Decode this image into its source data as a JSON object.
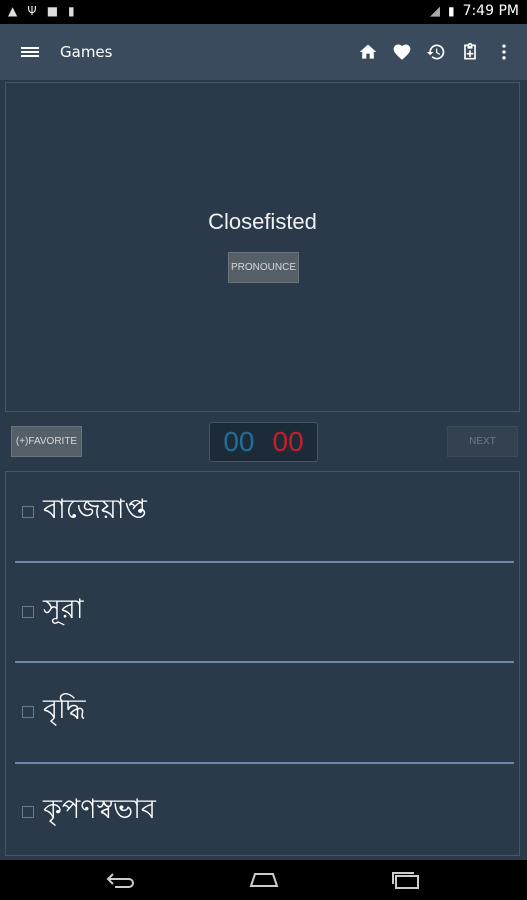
{
  "status_bar": {
    "time": "7:49",
    "time_suffix": "PM"
  },
  "app_bar": {
    "title": "Games",
    "actions": [
      "home-icon",
      "heart-icon",
      "history-icon",
      "clipboard-icon",
      "overflow-icon"
    ]
  },
  "quiz": {
    "word": "Closefisted",
    "pronounce_label": "PRONOUNCE",
    "favorite_label": "(+)FAVORITE",
    "next_label": "NEXT",
    "score_correct": "00",
    "score_wrong": "00",
    "options": [
      {
        "label": "বাজেয়াপ্ত",
        "checked": false
      },
      {
        "label": "সূরা",
        "checked": false
      },
      {
        "label": "বৃদ্ধি",
        "checked": false
      },
      {
        "label": "কৃপণস্বভাব",
        "checked": false
      }
    ]
  },
  "colors": {
    "background": "#2b3a4a",
    "app_bar": "#3a4b5e",
    "score_correct": "#1e6f9a",
    "score_wrong": "#c81e2a",
    "divider": "#6a87aa"
  }
}
